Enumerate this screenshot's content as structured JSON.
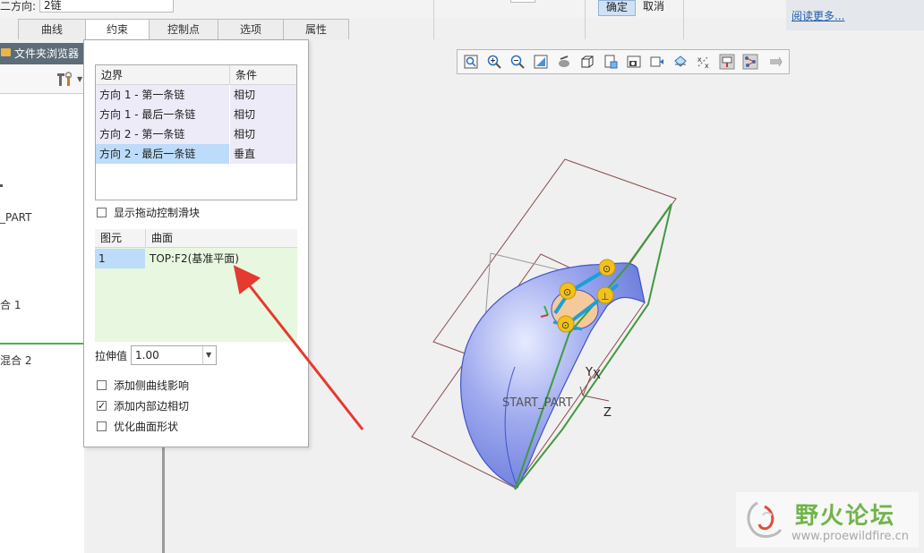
{
  "ribbon": {
    "direction_label": "二方向:",
    "direction_value": "2链",
    "ok_label": "确定",
    "cancel_label": "取消",
    "read_more_link": "阅读更多..."
  },
  "tabs": [
    {
      "label": "曲线",
      "active": false
    },
    {
      "label": "约束",
      "active": true
    },
    {
      "label": "控制点",
      "active": false
    },
    {
      "label": "选项",
      "active": false
    },
    {
      "label": "属性",
      "active": false
    }
  ],
  "navigator": {
    "header": "文件夹浏览器",
    "tree_items": [
      "_PART",
      "合 1",
      "混合 2"
    ]
  },
  "constraint_panel": {
    "boundary_table": {
      "headers": [
        "边界",
        "条件"
      ],
      "rows": [
        {
          "boundary": "方向 1 - 第一条链",
          "condition": "相切"
        },
        {
          "boundary": "方向 1 - 最后一条链",
          "condition": "相切"
        },
        {
          "boundary": "方向 2 - 第一条链",
          "condition": "相切"
        },
        {
          "boundary": "方向 2 - 最后一条链",
          "condition": "垂直"
        }
      ],
      "selected_row": 3
    },
    "show_drag_handles": {
      "label": "显示拖动控制滑块",
      "checked": false
    },
    "entity_table": {
      "headers": [
        "图元",
        "曲面"
      ],
      "rows": [
        {
          "entity": "1",
          "surface": "TOP:F2(基准平面)"
        }
      ]
    },
    "stretch": {
      "label": "拉伸值",
      "value": "1.00"
    },
    "options": [
      {
        "label": "添加侧曲线影响",
        "checked": false
      },
      {
        "label": "添加内部边相切",
        "checked": true
      },
      {
        "label": "优化曲面形状",
        "checked": false
      }
    ]
  },
  "graphics_toolbar": {
    "icons": [
      "refit-icon",
      "zoom-in-icon",
      "zoom-out-icon",
      "repaint-icon",
      "display-style-icon",
      "saved-orientations-icon",
      "view-manager-icon",
      "perspective-icon",
      "annotation-display-icon",
      "plane-display-icon",
      "axis-display-icon",
      "point-display-icon",
      "csys-display-icon",
      "spin-center-icon"
    ]
  },
  "viewport": {
    "model_label": "START_PART",
    "axis_labels": [
      "Y",
      "X",
      "Z"
    ]
  },
  "watermark": {
    "title": "野火论坛",
    "url": "www.proewildfire.cn"
  },
  "colors": {
    "accent_blue": "#bcdcf9",
    "surface_blue": "#7f93e8",
    "chain_green": "#3f9a3f",
    "arrow_red": "#e53a2f",
    "handle_yellow": "#f2c21b"
  }
}
